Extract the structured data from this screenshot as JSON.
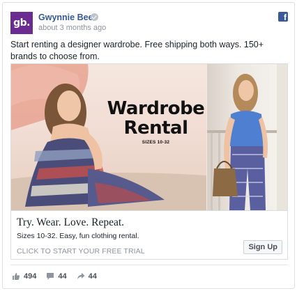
{
  "post": {
    "page_name": "Gwynnie Bee",
    "avatar_text": "gb.",
    "time": "about 3 months ago",
    "text": "Start renting a designer wardrobe. Free shipping both ways. 150+ brands to choose from."
  },
  "ad": {
    "image_title_line1": "Wardrobe",
    "image_title_line2": "Rental",
    "image_sizes": "SIZES 10-32",
    "headline": "Try. Wear. Love. Repeat.",
    "description": "Sizes 10-32. Easy, fun clothing rental.",
    "link_text": "CLICK TO START YOUR FREE TRIAL",
    "cta_label": "Sign Up"
  },
  "stats": {
    "likes": "494",
    "comments": "44",
    "shares": "44"
  },
  "colors": {
    "brand": "#6a2c91",
    "facebook": "#3b5998",
    "link": "#365899"
  }
}
